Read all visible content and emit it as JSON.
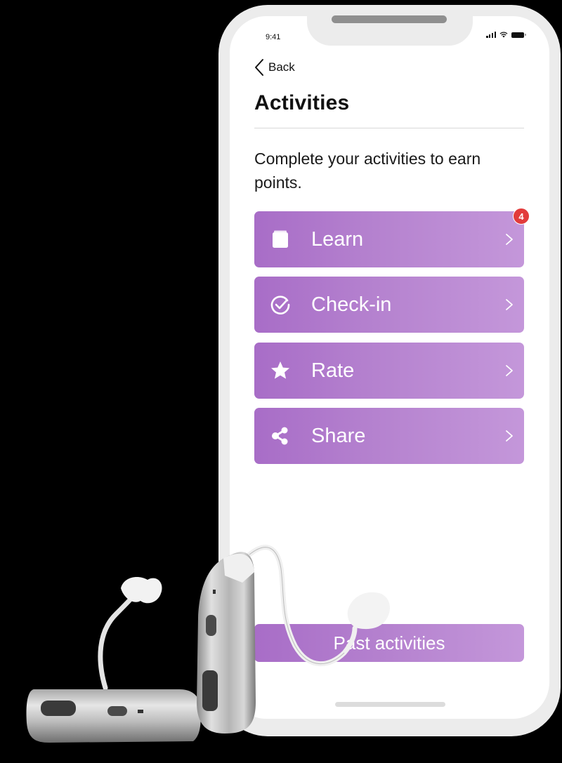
{
  "status_bar": {
    "time": "9:41",
    "icons": [
      "cellular-signal-icon",
      "wifi-icon",
      "battery-icon"
    ]
  },
  "nav": {
    "back_label": "Back",
    "back_icon": "chevron-left-icon"
  },
  "page": {
    "title": "Activities",
    "description": "Complete your activities to earn points."
  },
  "activities": [
    {
      "label": "Learn",
      "icon": "book-icon",
      "badge": "4"
    },
    {
      "label": "Check-in",
      "icon": "check-circle-icon"
    },
    {
      "label": "Rate",
      "icon": "star-icon"
    },
    {
      "label": "Share",
      "icon": "share-icon"
    }
  ],
  "footer": {
    "past_activities_label": "Past activities"
  },
  "colors": {
    "accent_start": "#a86dc7",
    "accent_end": "#c497da",
    "badge": "#e23b3b",
    "background": "#000000"
  },
  "decor": {
    "product_image": "hearing-aids"
  }
}
